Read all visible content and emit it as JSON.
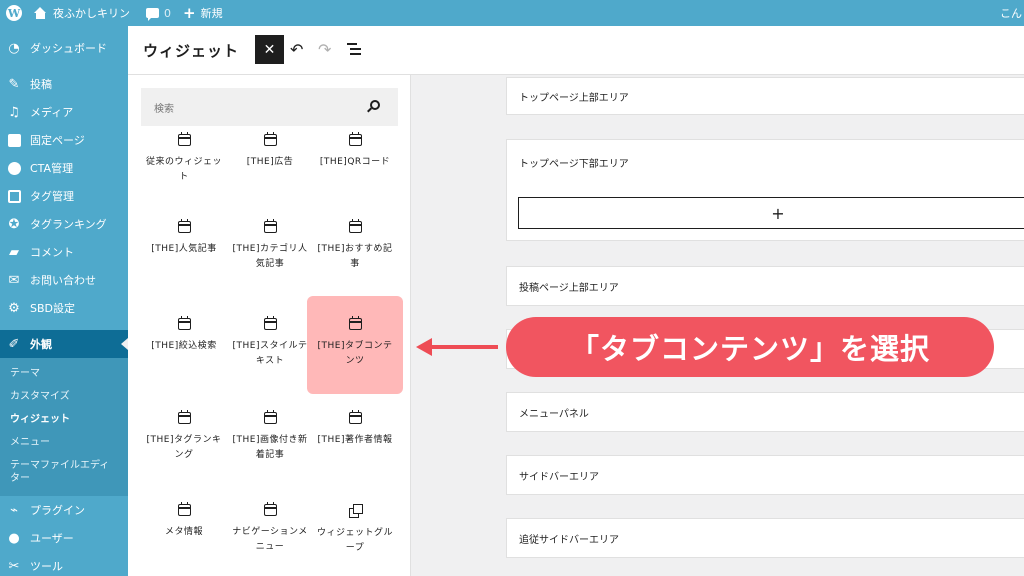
{
  "adminbar": {
    "site_name": "夜ふかしキリン",
    "comments_count": "0",
    "new_label": "新規",
    "greeting": "こん"
  },
  "sidebar": {
    "items": [
      {
        "label": "ダッシュボード",
        "icon": "dashboard-icon"
      },
      {
        "label": "投稿",
        "icon": "pin-icon"
      },
      {
        "label": "メディア",
        "icon": "media-icon"
      },
      {
        "label": "固定ページ",
        "icon": "page-icon"
      },
      {
        "label": "CTA管理",
        "icon": "lightbulb-icon"
      },
      {
        "label": "タグ管理",
        "icon": "tag-icon"
      },
      {
        "label": "タグランキング",
        "icon": "award-icon"
      },
      {
        "label": "コメント",
        "icon": "comment-icon"
      },
      {
        "label": "お問い合わせ",
        "icon": "mail-icon"
      },
      {
        "label": "SBD設定",
        "icon": "gear-icon"
      },
      {
        "label": "外観",
        "icon": "brush-icon"
      }
    ],
    "submenu": [
      "テーマ",
      "カスタマイズ",
      "ウィジェット",
      "メニュー",
      "テーマファイルエディター"
    ],
    "bottom_items": [
      {
        "label": "プラグイン",
        "icon": "plugin-icon"
      },
      {
        "label": "ユーザー",
        "icon": "user-icon"
      },
      {
        "label": "ツール",
        "icon": "wrench-icon"
      }
    ]
  },
  "editor": {
    "title": "ウィジェット",
    "close_symbol": "✕",
    "undo_symbol": "↶",
    "redo_symbol": "↷"
  },
  "inserter": {
    "search_placeholder": "検索",
    "blocks": [
      {
        "label": "従来のウィジェット",
        "icon": "calendar-icon"
      },
      {
        "label": "[THE]広告",
        "icon": "calendar-icon"
      },
      {
        "label": "[THE]QRコード",
        "icon": "calendar-icon"
      },
      {
        "label": "[THE]人気記事",
        "icon": "calendar-icon"
      },
      {
        "label": "[THE]カテゴリ人気記事",
        "icon": "calendar-icon"
      },
      {
        "label": "[THE]おすすめ記事",
        "icon": "calendar-icon"
      },
      {
        "label": "[THE]絞込検索",
        "icon": "calendar-icon"
      },
      {
        "label": "[THE]スタイルテキスト",
        "icon": "calendar-icon"
      },
      {
        "label": "[THE]タブコンテンツ",
        "icon": "calendar-icon"
      },
      {
        "label": "[THE]タグランキング",
        "icon": "calendar-icon"
      },
      {
        "label": "[THE]画像付き新着記事",
        "icon": "calendar-icon"
      },
      {
        "label": "[THE]著作者情報",
        "icon": "calendar-icon"
      },
      {
        "label": "メタ情報",
        "icon": "calendar-icon"
      },
      {
        "label": "ナビゲーションメニュー",
        "icon": "calendar-icon"
      },
      {
        "label": "ウィジェットグループ",
        "icon": "group-icon"
      }
    ]
  },
  "widget_areas": [
    {
      "label": "トップページ上部エリア"
    },
    {
      "label": "トップページ下部エリア"
    },
    {
      "label": "投稿ページ上部エリア"
    },
    {
      "label": "メニューパネル"
    },
    {
      "label": "サイドバーエリア"
    },
    {
      "label": "追従サイドバーエリア"
    }
  ],
  "add_block_symbol": "+",
  "annotation": {
    "text": "「タブコンテンツ」を選択",
    "color": "#f15560"
  }
}
